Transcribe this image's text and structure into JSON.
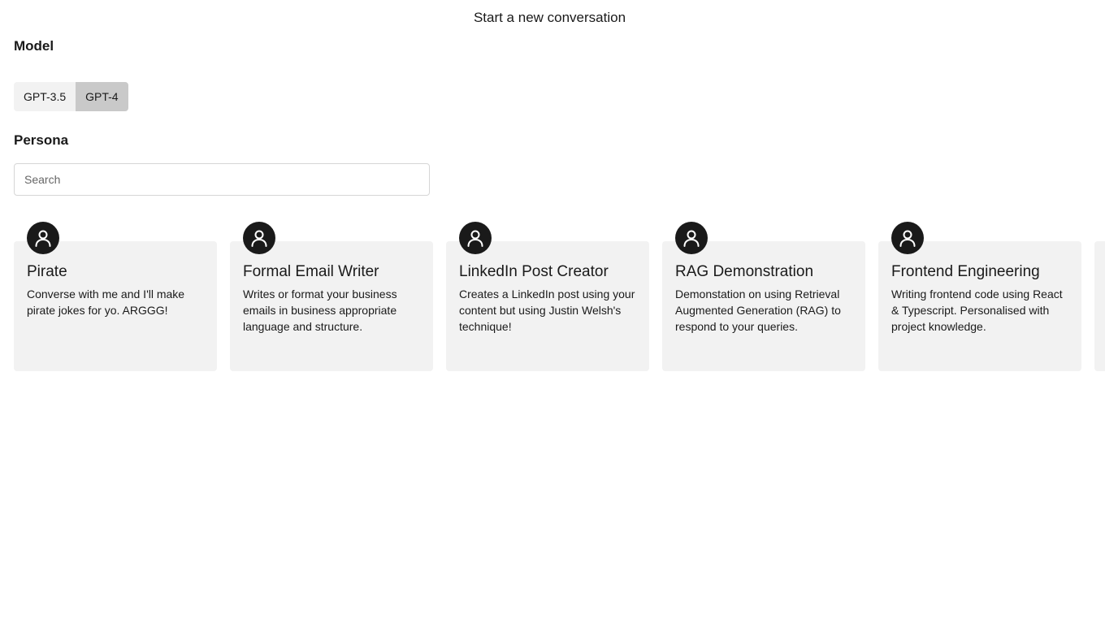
{
  "header": {
    "title": "Start a new conversation"
  },
  "model": {
    "label": "Model",
    "options": [
      "GPT-3.5",
      "GPT-4"
    ],
    "selected": "GPT-4"
  },
  "persona": {
    "label": "Persona",
    "search_placeholder": "Search",
    "search_value": "",
    "avatar_icon": "user-icon",
    "cards": [
      {
        "title": "Pirate",
        "description": "Converse with me and I'll make pirate jokes for yo. ARGGG!"
      },
      {
        "title": "Formal Email Writer",
        "description": "Writes or format your business emails in business appropriate language and structure."
      },
      {
        "title": "LinkedIn Post Creator",
        "description": "Creates a LinkedIn post using your content but using Justin Welsh's technique!"
      },
      {
        "title": "RAG Demonstration",
        "description": "Demonstation on using Retrieval Augmented Generation (RAG) to respond to your queries."
      },
      {
        "title": "Frontend Engineering",
        "description": "Writing frontend code using React & Typescript. Personalised with project knowledge."
      }
    ]
  },
  "colors": {
    "card_background": "#f2f2f2",
    "selected_toggle": "#c9c9c9",
    "avatar_background": "#1a1a1a"
  }
}
